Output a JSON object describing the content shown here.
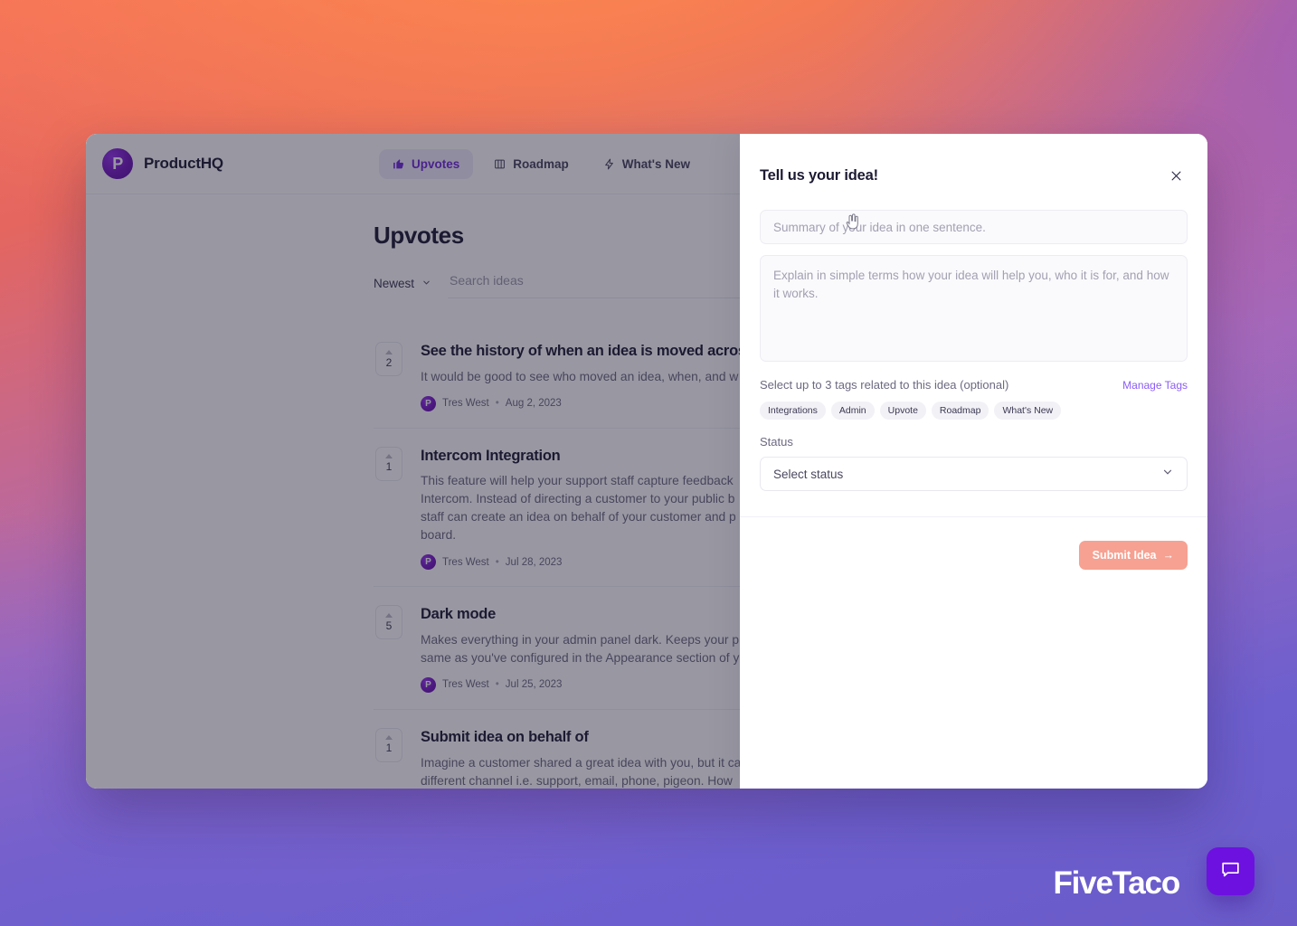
{
  "app": {
    "brand_initial": "P",
    "brand_name": "ProductHQ",
    "nav_tabs": [
      {
        "label": "Upvotes",
        "icon": "thumbs-up-icon",
        "active": true
      },
      {
        "label": "Roadmap",
        "icon": "columns-icon",
        "active": false
      },
      {
        "label": "What's New",
        "icon": "lightning-bolt-icon",
        "active": false
      }
    ]
  },
  "page": {
    "title": "Upvotes",
    "sort": {
      "value": "Newest",
      "icon": "chevron-down-icon"
    },
    "search": {
      "value": "",
      "placeholder": "Search ideas"
    }
  },
  "ideas": [
    {
      "votes": "2",
      "title": "See the history of when an idea is moved across the board and back",
      "description": "It would be good to see who moved an idea, when, and w",
      "author": "Tres West",
      "author_initial": "P",
      "date": "Aug 2, 2023",
      "separator": "•"
    },
    {
      "votes": "1",
      "title": "Intercom Integration",
      "description": "This feature will help your support staff capture feedback\nIntercom. Instead of directing a customer to your public b\nstaff can create an idea on behalf of your customer and p\nboard.",
      "author": "Tres West",
      "author_initial": "P",
      "date": "Jul 28, 2023",
      "separator": "•"
    },
    {
      "votes": "5",
      "title": "Dark mode",
      "description": "Makes everything in your admin panel dark. Keeps your p\nsame as you've configured in the Appearance section of y",
      "author": "Tres West",
      "author_initial": "P",
      "date": "Jul 25, 2023",
      "separator": "•"
    },
    {
      "votes": "1",
      "title": "Submit idea on behalf of",
      "description": "Imagine a customer shared a great idea with you, but it ca\ndifferent channel i.e. support, email, phone, pigeon. How\nidea into your ideas board and associate it with that custo\non behalf of\" allows you to create an idea in your ideas bo",
      "author": "",
      "author_initial": "",
      "date": "",
      "separator": ""
    }
  ],
  "modal": {
    "title": "Tell us your idea!",
    "close_icon": "close-icon",
    "summary": {
      "value": "",
      "placeholder": "Summary of your idea in one sentence."
    },
    "detail": {
      "value": "",
      "placeholder": "Explain in simple terms how your idea will help you, who it is for, and how it works."
    },
    "tags_hint": "Select up to 3 tags related to this idea (optional)",
    "manage_tags_label": "Manage Tags",
    "tags": [
      "Integrations",
      "Admin",
      "Upvote",
      "Roadmap",
      "What's New"
    ],
    "status_label": "Status",
    "status_value": "Select status",
    "status_icon": "chevron-down-icon",
    "submit_label": "Submit Idea",
    "submit_arrow": "→"
  },
  "chat_widget": {
    "icon": "chat-bubble-icon"
  },
  "watermark": {
    "text": "FiveTaco"
  },
  "colors": {
    "brand_purple": "#7216BE",
    "accent_purple": "#6D28D9",
    "manage_tags_link": "#8B5CF6",
    "submit_button": "#F6A192",
    "chat_widget": "#6D11E0",
    "text_dark": "#1C1A33",
    "text_muted": "#6C6981"
  }
}
